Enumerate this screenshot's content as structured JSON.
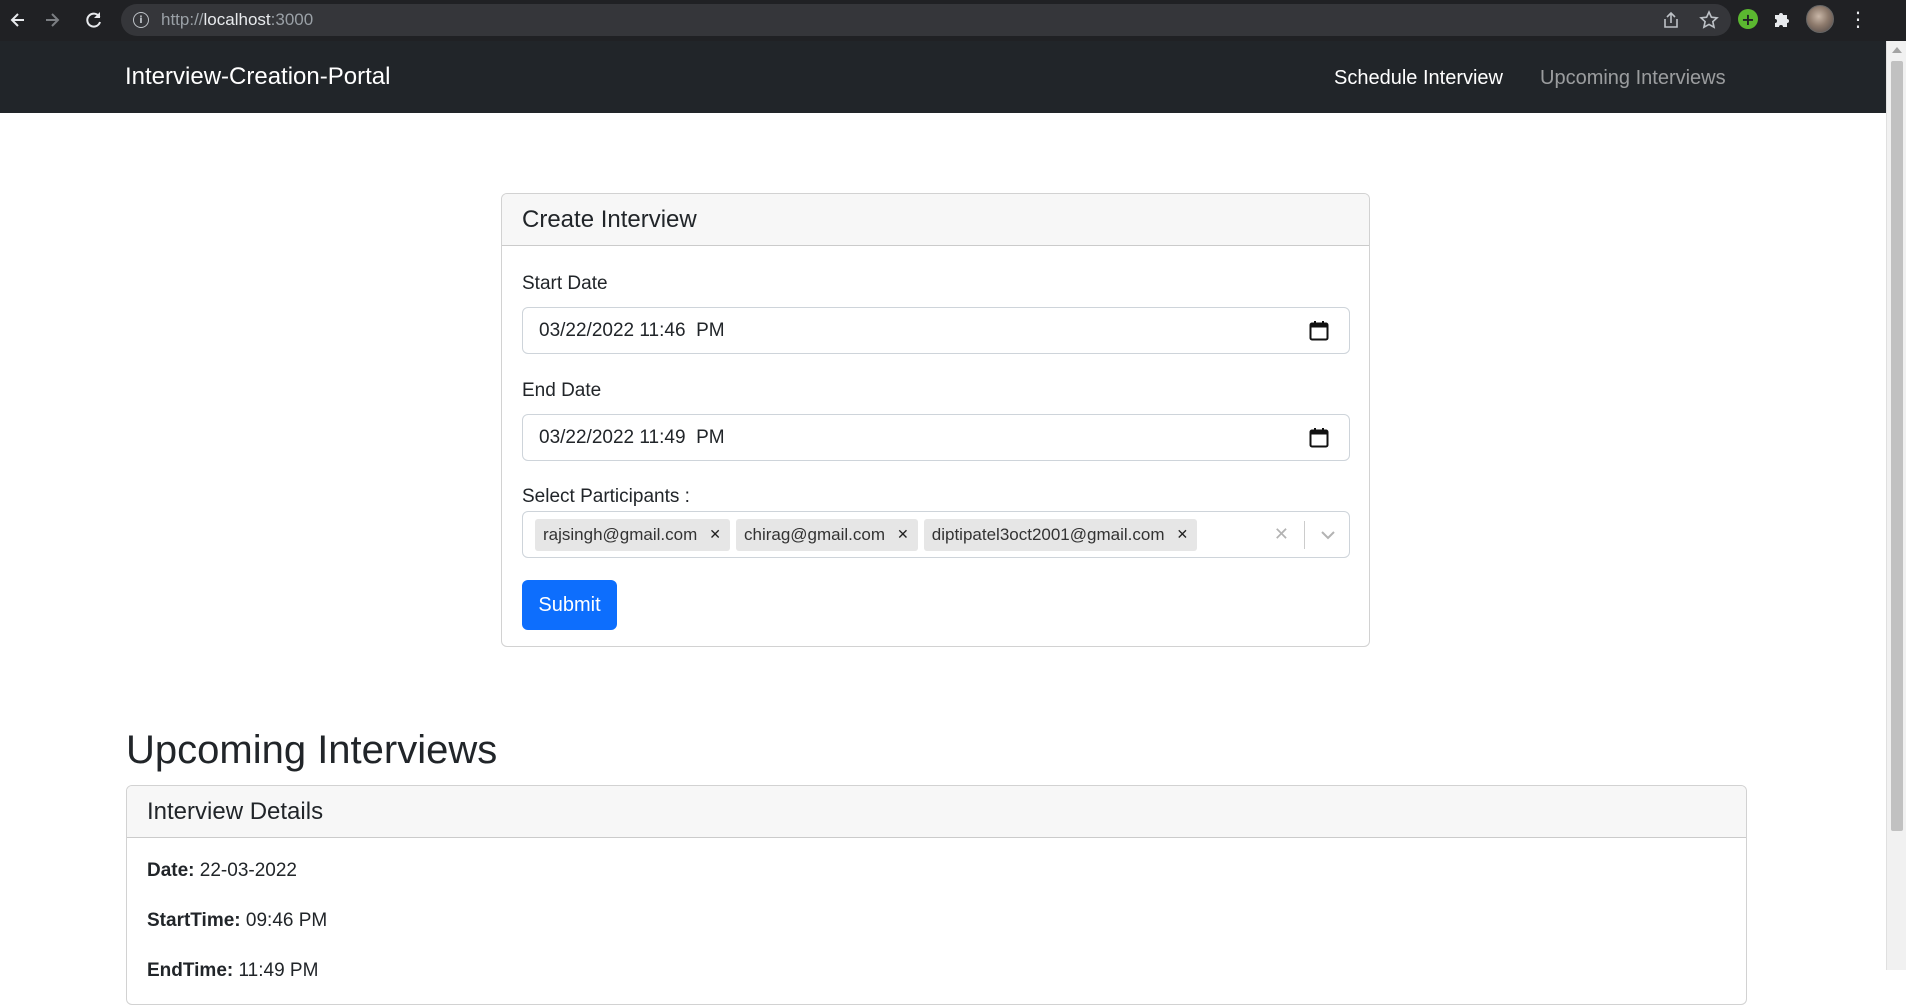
{
  "browser": {
    "url_prefix": "http://",
    "url_host": "localhost",
    "url_port": ":3000"
  },
  "navbar": {
    "brand": "Interview-Creation-Portal",
    "links": [
      "Schedule Interview",
      "Upcoming Interviews"
    ]
  },
  "create_form": {
    "title": "Create Interview",
    "start_label": "Start Date",
    "start_value": "03/22/2022 11:46  PM",
    "end_label": "End Date",
    "end_value": "03/22/2022 11:49  PM",
    "participants_label": "Select Participants :",
    "participants": [
      "rajsingh@gmail.com",
      "chirag@gmail.com",
      "diptipatel3oct2001@gmail.com"
    ],
    "submit_label": "Submit"
  },
  "upcoming": {
    "section_title": "Upcoming Interviews",
    "card_title": "Interview Details",
    "details": [
      {
        "label": "Date:",
        "value": "22-03-2022"
      },
      {
        "label": "StartTime:",
        "value": "09:46 PM"
      },
      {
        "label": "EndTime:",
        "value": "11:49 PM"
      }
    ]
  },
  "colors": {
    "navbar_bg": "#212529",
    "primary": "#0d6efd"
  }
}
